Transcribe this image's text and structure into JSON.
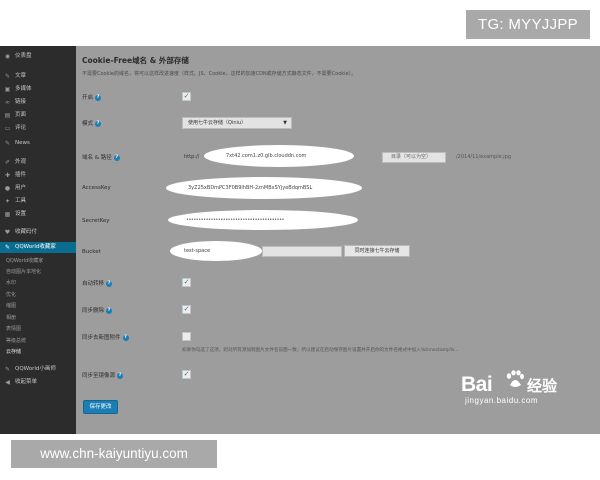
{
  "overlay": {
    "tag": "TG: MYYJJPP",
    "url": "www.chn-kaiyuntiyu.com"
  },
  "watermark": {
    "brand_left": "Bai",
    "brand_right": "经验",
    "url": "jingyan.baidu.com"
  },
  "sidebar": {
    "items": [
      {
        "label": "仪表盘",
        "icon": "dashboard-icon"
      },
      {
        "label": "文章",
        "icon": "pin-icon"
      },
      {
        "label": "多媒体",
        "icon": "media-icon"
      },
      {
        "label": "链接",
        "icon": "link-icon"
      },
      {
        "label": "页面",
        "icon": "page-icon"
      },
      {
        "label": "评论",
        "icon": "comment-icon"
      },
      {
        "label": "News",
        "icon": "pin-icon"
      },
      {
        "label": "外观",
        "icon": "brush-icon"
      },
      {
        "label": "插件",
        "icon": "plugin-icon"
      },
      {
        "label": "用户",
        "icon": "user-icon"
      },
      {
        "label": "工具",
        "icon": "wrench-icon"
      },
      {
        "label": "设置",
        "icon": "settings-icon"
      },
      {
        "label": "收藏码付",
        "icon": "heart-icon"
      },
      {
        "label": "QQWorld收藏家",
        "icon": "pin-icon"
      }
    ],
    "subitems": [
      "QQWorld收藏家",
      "自动图片本地化",
      "水印",
      "优化",
      "缩图",
      "相册",
      "表情图",
      "等级总统",
      "云存储"
    ],
    "bottom_items": [
      {
        "label": "QQWorld小画师",
        "icon": "pin-icon"
      },
      {
        "label": "收起菜单",
        "icon": "collapse-icon"
      }
    ]
  },
  "form": {
    "title": "Cookie-Free域名 & 外部存储",
    "description": "不需要Cookie的域名，将可以这样改进速度（样式、JS、Cookie，这样的加速CDN或存储方式静态文件，不需要Cookie）。",
    "enable_label": "开启",
    "mode_label": "模式",
    "mode_value": "使用七牛云存储（Qiniu）",
    "domain_label": "域名 & 路径",
    "domain_protocol": "http://",
    "domain_value": "7xt42.com1.z0.glb.clouddn.com",
    "path_value": "目录（可以为空）",
    "path_example": "/2014/11/example.jpg",
    "accesskey_label": "AccessKey",
    "accesskey_value": "3yZ25xBDmPC3F0B9lhBH-2znMBxSYjyeBdqmBSL",
    "secretkey_label": "SecretKey",
    "secretkey_value": "••••••••••••••••••••••••••••••••••••••••",
    "bucket_label": "Bucket",
    "bucket_value": "test-space",
    "bucket_button": "同时连接七牛云存储",
    "auto_sync_label": "自动转移",
    "sync_delete_label": "同步删除",
    "sync_new_label": "同步去新图附件",
    "sync_new_hint": "如果你勾选了这项，则对所有添加到图片文件名前面一致，所以建议在启动保存图片设置并开启你的文件名格式中加入%timestamp%...",
    "sync_mirror_label": "同步至镜像源",
    "save_button": "保存更改",
    "help_glyph": "?",
    "check_glyph": "✓"
  }
}
